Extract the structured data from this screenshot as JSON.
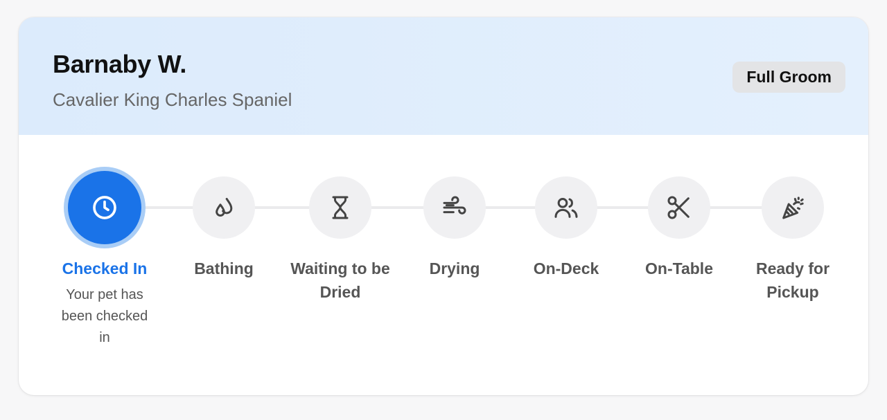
{
  "pet": {
    "name": "Barnaby W.",
    "breed": "Cavalier King Charles Spaniel",
    "service": "Full Groom"
  },
  "colors": {
    "accent": "#1a73e8",
    "header_bg": "#dcebfc",
    "inactive_circle": "#f0f0f2"
  },
  "steps": [
    {
      "label": "Checked In",
      "icon": "clock-icon",
      "description": "Your pet has been checked in",
      "active": true
    },
    {
      "label": "Bathing",
      "icon": "water-drops-icon",
      "active": false
    },
    {
      "label": "Waiting to be Dried",
      "icon": "hourglass-icon",
      "active": false
    },
    {
      "label": "Drying",
      "icon": "wind-icon",
      "active": false
    },
    {
      "label": "On-Deck",
      "icon": "users-icon",
      "active": false
    },
    {
      "label": "On-Table",
      "icon": "scissors-icon",
      "active": false
    },
    {
      "label": "Ready for Pickup",
      "icon": "party-popper-icon",
      "active": false
    }
  ]
}
